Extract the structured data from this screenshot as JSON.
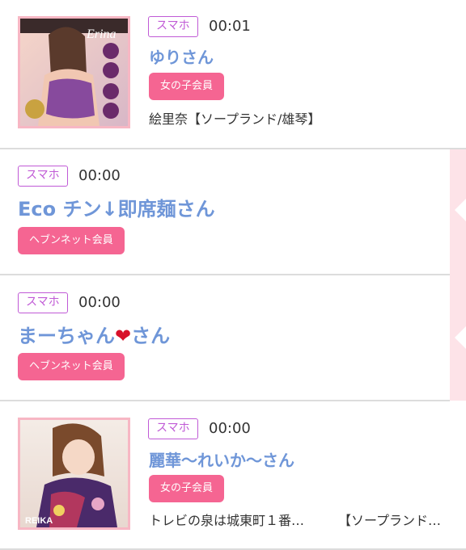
{
  "entries": [
    {
      "device": "スマホ",
      "time": "00:01",
      "name": "ゆりさん",
      "member": "女の子会員",
      "shop": "絵里奈【ソープランド/雄琴】",
      "thumb_text": "Erina",
      "thumb_icon": "woman-photo"
    },
    {
      "device": "スマホ",
      "time": "00:00",
      "name": "Eco チン↓即席麺さん",
      "member": "ヘブンネット会員"
    },
    {
      "device": "スマホ",
      "time": "00:00",
      "name_prefix": "まーちゃん",
      "name_heart": "❤",
      "name_suffix": "さん",
      "member": "ヘブンネット会員"
    },
    {
      "device": "スマホ",
      "time": "00:00",
      "name": "麗華〜れいか〜さん",
      "member": "女の子会員",
      "shop_left": "トレビの泉は城東町１番…",
      "shop_right": "【ソープランド…",
      "thumb_text": "REIKA",
      "thumb_icon": "woman-photo"
    }
  ],
  "colors": {
    "accent_pink": "#f56592",
    "badge_purple": "#c05ad6",
    "name_blue": "#6f96d8",
    "strip_pink": "#fde3e8"
  }
}
